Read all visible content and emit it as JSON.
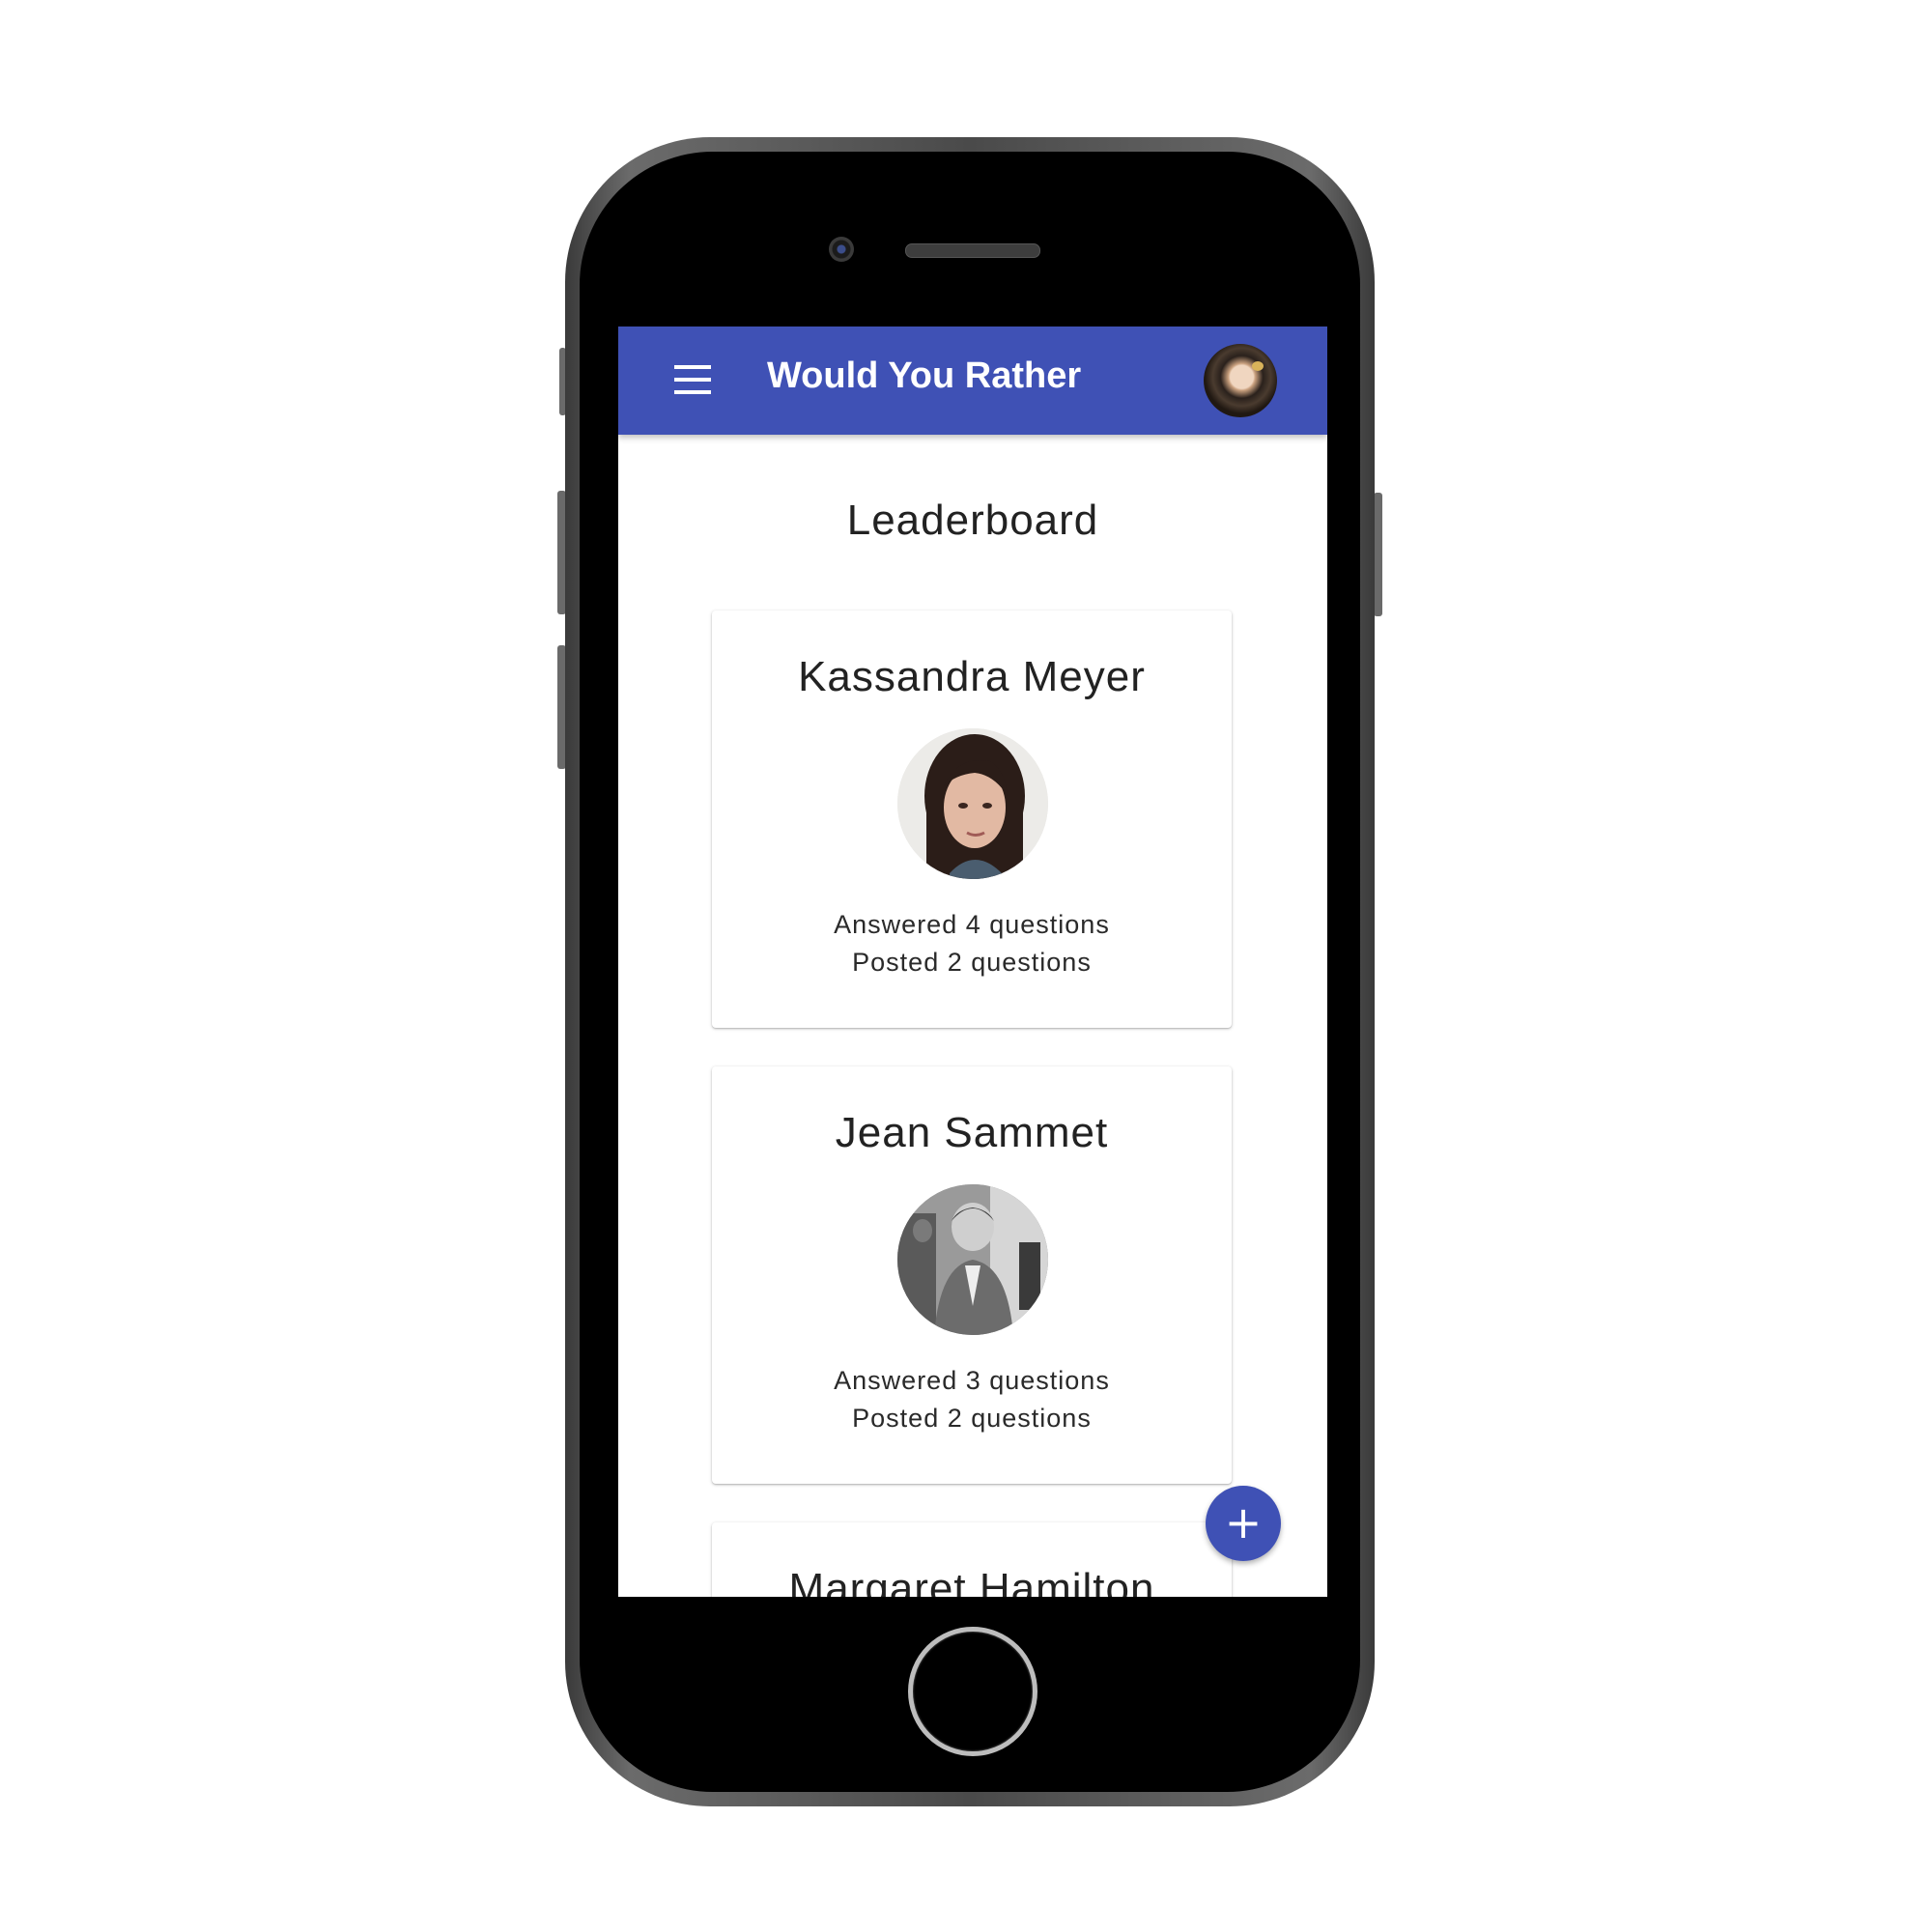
{
  "appbar": {
    "title": "Would You Rather",
    "menu_icon": "menu-icon",
    "avatar_icon": "user-avatar"
  },
  "page": {
    "title": "Leaderboard"
  },
  "leaderboard": [
    {
      "name": "Kassandra Meyer",
      "answered": "Answered 4 questions",
      "posted": "Posted 2 questions"
    },
    {
      "name": "Jean Sammet",
      "answered": "Answered 3 questions",
      "posted": "Posted 2 questions"
    },
    {
      "name": "Margaret Hamilton"
    }
  ],
  "fab": {
    "label": "+",
    "icon": "plus-icon"
  },
  "colors": {
    "primary": "#3f51b5",
    "background": "#ffffff",
    "text": "#222222"
  }
}
